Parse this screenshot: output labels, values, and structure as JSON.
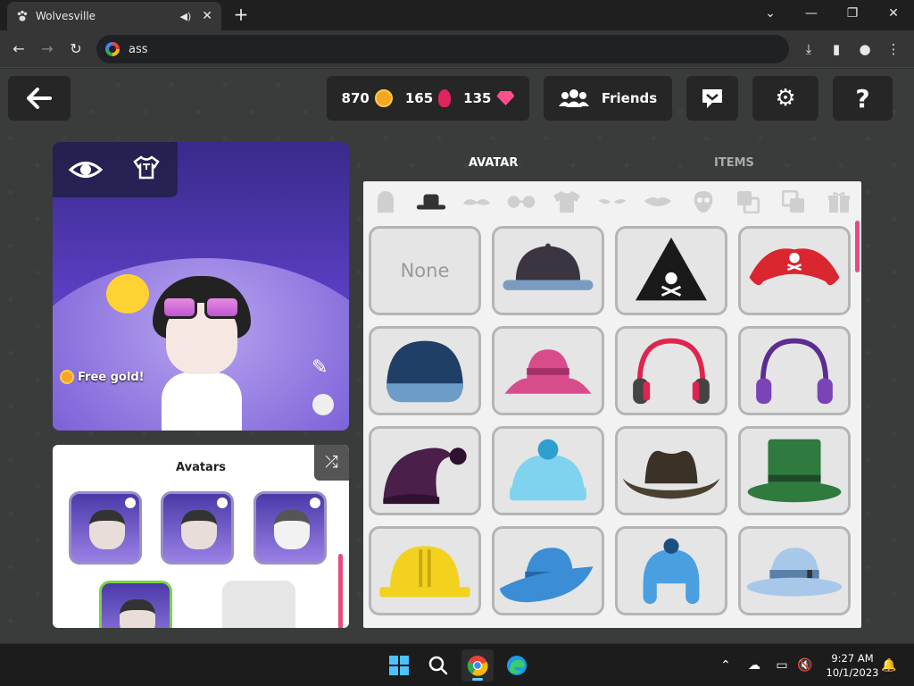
{
  "browser": {
    "tab_title": "Wolvesville",
    "address": "ass"
  },
  "header": {
    "gold": "870",
    "roses": "165",
    "gems": "135",
    "friends_label": "Friends",
    "help_label": "?"
  },
  "preview": {
    "free_gold_label": "Free gold!"
  },
  "avatars_panel": {
    "title": "Avatars"
  },
  "wardrobe": {
    "tabs": [
      "AVATAR",
      "ITEMS"
    ],
    "active_tab": "AVATAR",
    "categories": [
      "gravestone-icon",
      "hat-icon",
      "mustache-icon",
      "glasses-icon",
      "shirt-icon",
      "eyes-icon",
      "mouth-icon",
      "mask-icon",
      "back-layer-icon",
      "front-layer-icon",
      "gift-icon"
    ],
    "active_category": "hat-icon",
    "none_label": "None",
    "items": [
      {
        "name": "snapback-cap",
        "colors": [
          "#3a3540",
          "#7a9cc0"
        ]
      },
      {
        "name": "witch-hat-skull",
        "colors": [
          "#1a1a1a",
          "#ffffff"
        ]
      },
      {
        "name": "pirate-hat",
        "colors": [
          "#d9262f",
          "#ffffff"
        ]
      },
      {
        "name": "navy-cap",
        "colors": [
          "#1f3f66",
          "#6c9cc8"
        ]
      },
      {
        "name": "pink-bucket-hat",
        "colors": [
          "#d94c8c",
          "#a33067"
        ]
      },
      {
        "name": "red-headphones",
        "colors": [
          "#e0244f",
          "#444444"
        ]
      },
      {
        "name": "purple-headphones",
        "colors": [
          "#5b2d91",
          "#7a44b8"
        ]
      },
      {
        "name": "purple-nightcap",
        "colors": [
          "#4a1f4a",
          "#2f122f"
        ]
      },
      {
        "name": "blue-beanie",
        "colors": [
          "#7fd3ee",
          "#2f9fd0"
        ]
      },
      {
        "name": "cowboy-hat",
        "colors": [
          "#4a4030",
          "#3a3226"
        ]
      },
      {
        "name": "green-top-hat",
        "colors": [
          "#2f7a3f",
          "#1f4a28"
        ]
      },
      {
        "name": "hard-hat",
        "colors": [
          "#f2d21e",
          "#c9a80e"
        ]
      },
      {
        "name": "blue-fedora",
        "colors": [
          "#3b8ed6",
          "#2466a8"
        ]
      },
      {
        "name": "blue-trapper-hat",
        "colors": [
          "#4a9fe0",
          "#1a4f80"
        ]
      },
      {
        "name": "light-blue-fedora",
        "colors": [
          "#a8c8ea",
          "#5a7fa8"
        ]
      }
    ]
  },
  "taskbar": {
    "time": "9:27 AM",
    "date": "10/1/2023"
  }
}
